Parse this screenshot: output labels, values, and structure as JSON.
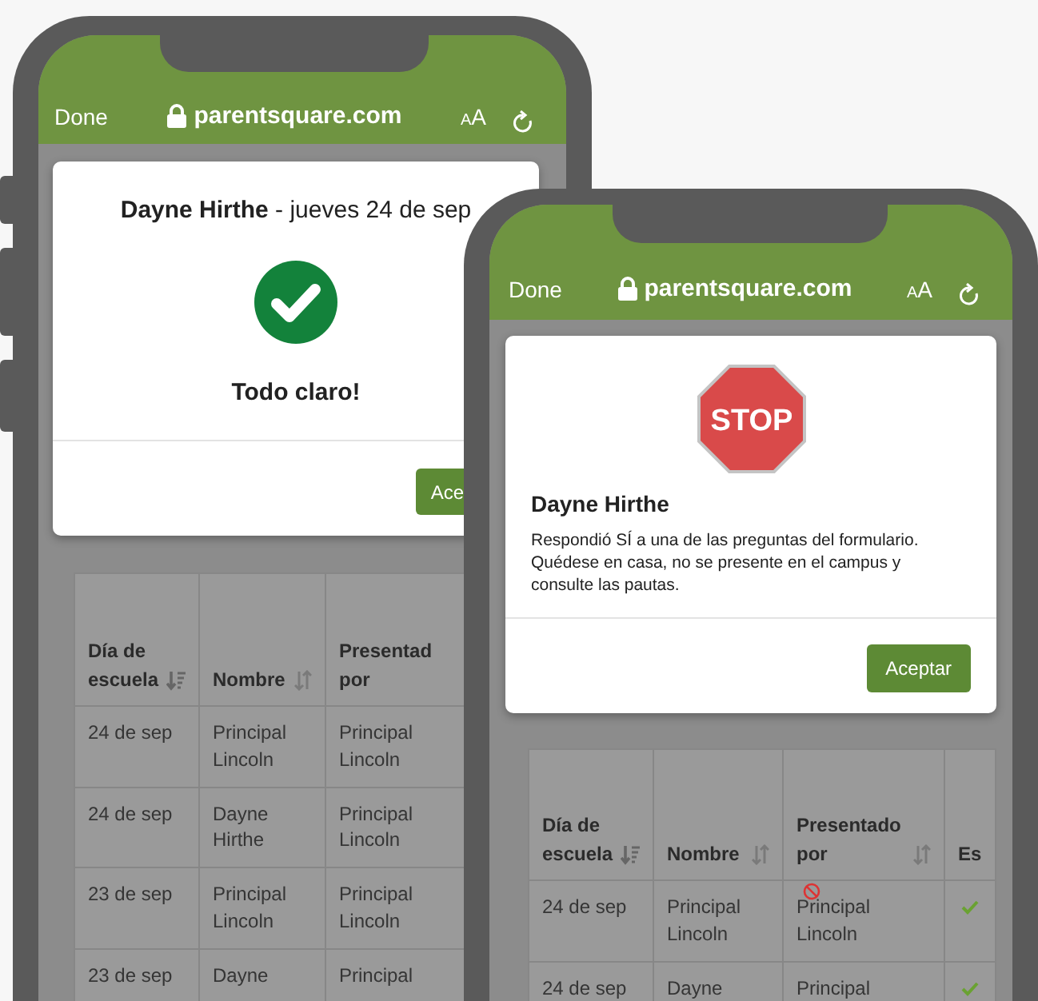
{
  "phones": [
    {
      "browser": {
        "done": "Done",
        "url": "parentsquare.com",
        "text_size": "AA"
      },
      "modal": {
        "kind": "clear",
        "title": "**Dayne Hirthe** - jueves 24 de sep",
        "status": "Todo claro!",
        "button": "Ace"
      },
      "table": {
        "columns": [
          {
            "label": "Día de\nescuela",
            "sortable": true,
            "sorted": true
          },
          {
            "label": "Nombre",
            "sortable": true,
            "sorted": false
          },
          {
            "label": "Presentad\npor",
            "sortable": false
          }
        ],
        "rows": [
          {
            "cells": [
              "24 de sep",
              "Principal Lincoln",
              "Principal Lincoln"
            ]
          },
          {
            "cells": [
              "24 de sep",
              "Dayne Hirthe",
              "Principal Lincoln"
            ]
          },
          {
            "cells": [
              "23 de sep",
              "Principal Lincoln",
              "Principal Lincoln"
            ]
          },
          {
            "cells": [
              "23 de sep",
              "Dayne",
              "Principal"
            ]
          }
        ]
      }
    },
    {
      "browser": {
        "done": "Done",
        "url": "parentsquare.com",
        "text_size": "AA"
      },
      "modal": {
        "kind": "stop",
        "sign": "STOP",
        "name": "Dayne Hirthe",
        "message": "Respondió SÍ a una de las preguntas del formulario. Quédese en casa, no se presente en el campus y consulte las pautas.",
        "button": "Aceptar"
      },
      "table": {
        "columns": [
          {
            "label": "Día de\nescuela",
            "sortable": true,
            "sorted": true
          },
          {
            "label": "Nombre",
            "sortable": true,
            "sorted": false
          },
          {
            "label": "Presentado\npor",
            "sortable": true,
            "sorted": false
          },
          {
            "label": "Es",
            "sortable": false
          }
        ],
        "rows": [
          {
            "cells": [
              "24 de sep",
              "Principal Lincoln",
              "Principal Lincoln"
            ],
            "blocked": true,
            "cleared": true
          },
          {
            "cells": [
              "24 de sep",
              "Dayne",
              "Principal"
            ],
            "blocked": false,
            "cleared": true
          }
        ]
      }
    }
  ]
}
